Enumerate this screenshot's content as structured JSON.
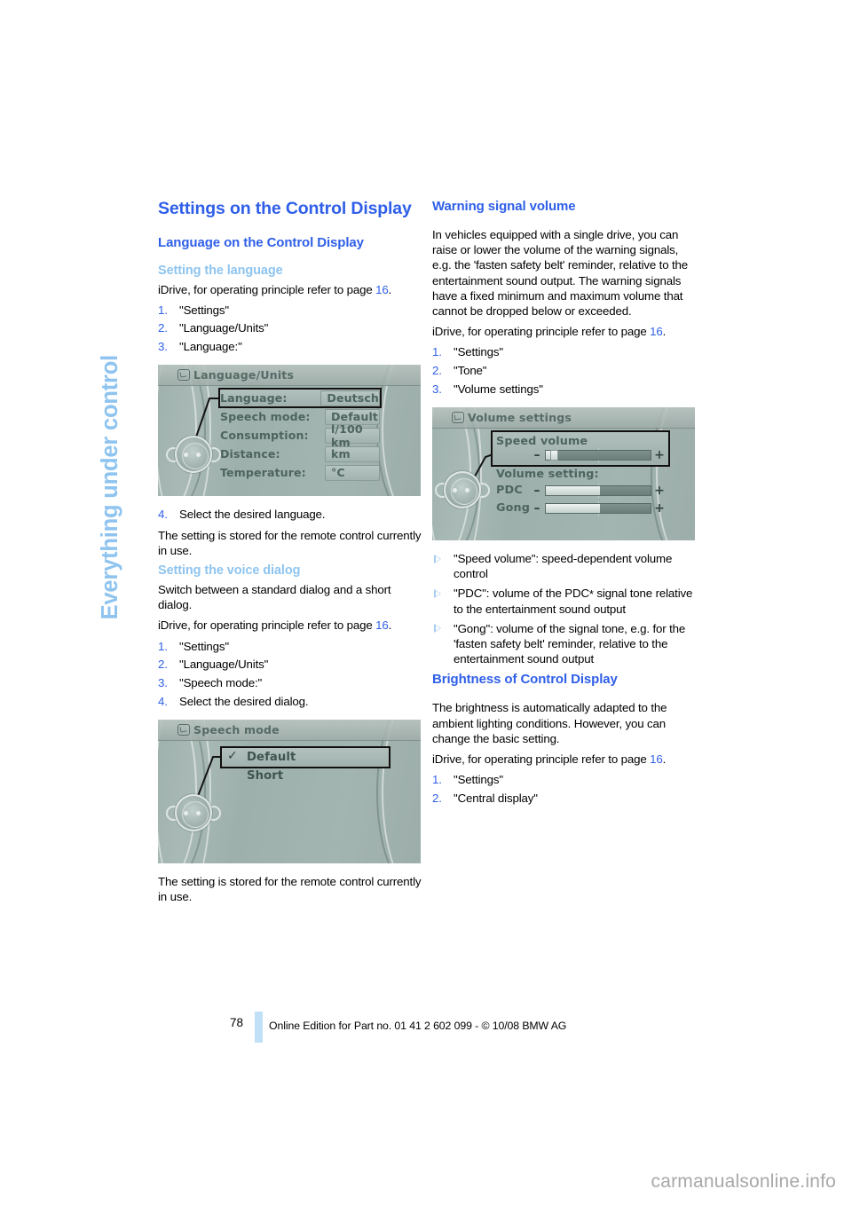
{
  "document": {
    "chapter_tab": "Everything under control",
    "page_number": "78",
    "footer_edition": "Online Edition for Part no. 01 41 2 602 099 - © 10/08 BMW AG",
    "watermark": "carmanualsonline.info"
  },
  "colors": {
    "heading_blue": "#2f5fe8",
    "subheading_light_blue": "#8ec4ef",
    "tab_blue": "#8ec4ef",
    "footer_bar": "#bfe0f6",
    "screen_grey": "#a3b5b1"
  },
  "left_column": {
    "title": "Settings on the Control Display",
    "h2_language": "Language on the Control Display",
    "h3_setting_language": "Setting the language",
    "idrive_ref_1": {
      "prefix": "iDrive, for operating principle refer to page ",
      "page": "16",
      "suffix": "."
    },
    "steps_language": [
      {
        "num": "1.",
        "text": "\"Settings\""
      },
      {
        "num": "2.",
        "text": "\"Language/Units\""
      },
      {
        "num": "3.",
        "text": "\"Language:\""
      }
    ],
    "screenshot_language_units": {
      "header_title": "Language/Units",
      "header_icon": "screen-icon",
      "rows": [
        {
          "label": "Language:",
          "value": "Deutsch",
          "selected": true
        },
        {
          "label": "Speech mode:",
          "value": "Default",
          "selected": false
        },
        {
          "label": "Consumption:",
          "value": "l/100 km",
          "selected": false
        },
        {
          "label": "Distance:",
          "value": "km",
          "selected": false
        },
        {
          "label": "Temperature:",
          "value": "°C",
          "selected": false
        }
      ]
    },
    "step_4_language": {
      "num": "4.",
      "text": "Select the desired language."
    },
    "stored_note_1": "The setting is stored for the remote control currently in use.",
    "h3_voice_dialog": "Setting the voice dialog",
    "voice_intro": "Switch between a standard dialog and a short dialog.",
    "idrive_ref_2": {
      "prefix": "iDrive, for operating principle refer to page ",
      "page": "16",
      "suffix": "."
    },
    "steps_voice": [
      {
        "num": "1.",
        "text": "\"Settings\""
      },
      {
        "num": "2.",
        "text": "\"Language/Units\""
      },
      {
        "num": "3.",
        "text": "\"Speech mode:\""
      },
      {
        "num": "4.",
        "text": "Select the desired dialog."
      }
    ],
    "screenshot_speech_mode": {
      "header_title": "Speech mode",
      "header_icon": "screen-icon",
      "options": [
        {
          "label": "Default",
          "checked": true,
          "selected": true
        },
        {
          "label": "Short",
          "checked": false,
          "selected": false
        }
      ],
      "check_glyph": "✓"
    },
    "stored_note_2": "The setting is stored for the remote control currently in use."
  },
  "right_column": {
    "h2_warning_volume": "Warning signal volume",
    "warning_paragraph": "In vehicles equipped with a single drive, you can raise or lower the volume of the warning signals, e.g. the 'fasten safety belt' reminder, relative to the entertainment sound output. The warning signals have a fixed minimum and maximum volume that cannot be dropped below or exceeded.",
    "idrive_ref_3": {
      "prefix": "iDrive, for operating principle refer to page ",
      "page": "16",
      "suffix": "."
    },
    "steps_volume": [
      {
        "num": "1.",
        "text": "\"Settings\""
      },
      {
        "num": "2.",
        "text": "\"Tone\""
      },
      {
        "num": "3.",
        "text": "\"Volume settings\""
      }
    ],
    "screenshot_volume_settings": {
      "header_title": "Volume settings",
      "header_icon": "speaker-icon",
      "speed_volume": {
        "title": "Speed volume",
        "minus": "–",
        "plus": "+",
        "fill_percent": 4,
        "thumb_percent": 7,
        "selected": true
      },
      "volume_setting_label": "Volume setting:",
      "sliders": [
        {
          "name": "PDC",
          "minus": "–",
          "plus": "+",
          "fill_percent": 52
        },
        {
          "name": "Gong",
          "minus": "–",
          "plus": "+",
          "fill_percent": 52
        }
      ]
    },
    "bullets": [
      {
        "text": "\"Speed volume\": speed-dependent volume control"
      },
      {
        "text_before": "\"PDC\": volume of the PDC",
        "asterisk": "*",
        "text_after": " signal tone relative to the entertainment sound output"
      },
      {
        "text": "\"Gong\": volume of the signal tone, e.g. for the 'fasten safety belt' reminder, relative to the entertainment sound output"
      }
    ],
    "h2_brightness": "Brightness of Control Display",
    "brightness_paragraph": "The brightness is automatically adapted to the ambient lighting conditions. However, you can change the basic setting.",
    "idrive_ref_4": {
      "prefix": "iDrive, for operating principle refer to page ",
      "page": "16",
      "suffix": "."
    },
    "steps_brightness": [
      {
        "num": "1.",
        "text": "\"Settings\""
      },
      {
        "num": "2.",
        "text": "\"Central display\""
      }
    ]
  }
}
